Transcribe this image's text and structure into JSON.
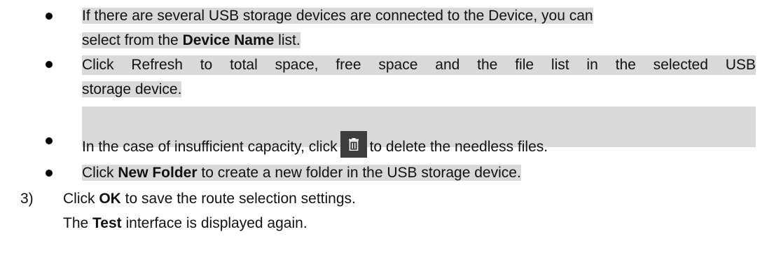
{
  "bullets": [
    {
      "line1_text": "If there are several USB storage devices are connected to the Device, you can",
      "line2_prefix": "select from the ",
      "line2_bold": "Device Name",
      "line2_suffix": " list."
    },
    {
      "line1_words": [
        "Click",
        "Refresh",
        "to",
        "total",
        "space,",
        "free",
        "space",
        "and",
        "the",
        "file",
        "list",
        "in",
        "the",
        "selected",
        "USB"
      ],
      "line2_text": "storage device."
    },
    {
      "prefix": "In the case of insufficient capacity, click",
      "icon": "trash-icon",
      "suffix": "to delete the needless files."
    },
    {
      "prefix": "Click ",
      "bold": "New Folder",
      "suffix": " to create a new folder in the USB storage device."
    }
  ],
  "step": {
    "number": "3)",
    "line1_prefix": "Click ",
    "line1_bold": "OK",
    "line1_suffix": " to save the route selection settings.",
    "line2_prefix": "The ",
    "line2_bold": "Test",
    "line2_suffix": " interface is displayed again."
  },
  "colors": {
    "highlight": "#d9d9d9",
    "icon_bg": "#3d3d3d",
    "icon_fg": "#ffffff"
  }
}
